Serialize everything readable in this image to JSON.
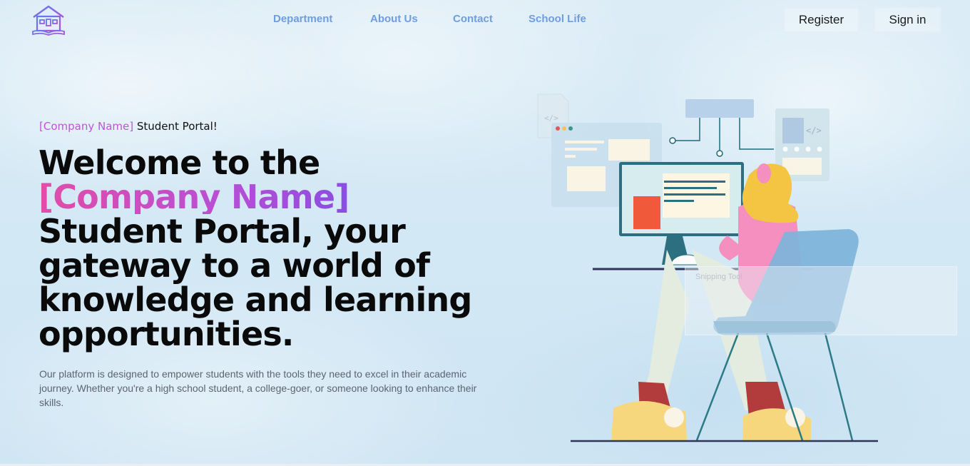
{
  "header": {
    "logo_icon": "school-book-icon",
    "nav": [
      {
        "label": "Department"
      },
      {
        "label": "About Us"
      },
      {
        "label": "Contact"
      },
      {
        "label": "School Life"
      }
    ],
    "register_label": "Register",
    "signin_label": "Sign in"
  },
  "hero": {
    "eyebrow_company": "[Company Name]",
    "eyebrow_rest": " Student Portal!",
    "headline_line1": "Welcome to the",
    "headline_company": "[Company Name]",
    "headline_rest": "Student Portal, your gateway to a world of knowledge and learning opportunities.",
    "description": "Our platform is designed to empower students with the tools they need to excel in their academic journey. Whether you're a high school student, a college-goer, or someone looking to enhance their skills."
  },
  "overlay": {
    "snipping_label": "Snipping Tool"
  },
  "colors": {
    "nav_link": "#6e9ee0",
    "accent_gradient_start": "#e24da8",
    "accent_gradient_end": "#8a4ee0",
    "headline": "#0a0a0a"
  }
}
